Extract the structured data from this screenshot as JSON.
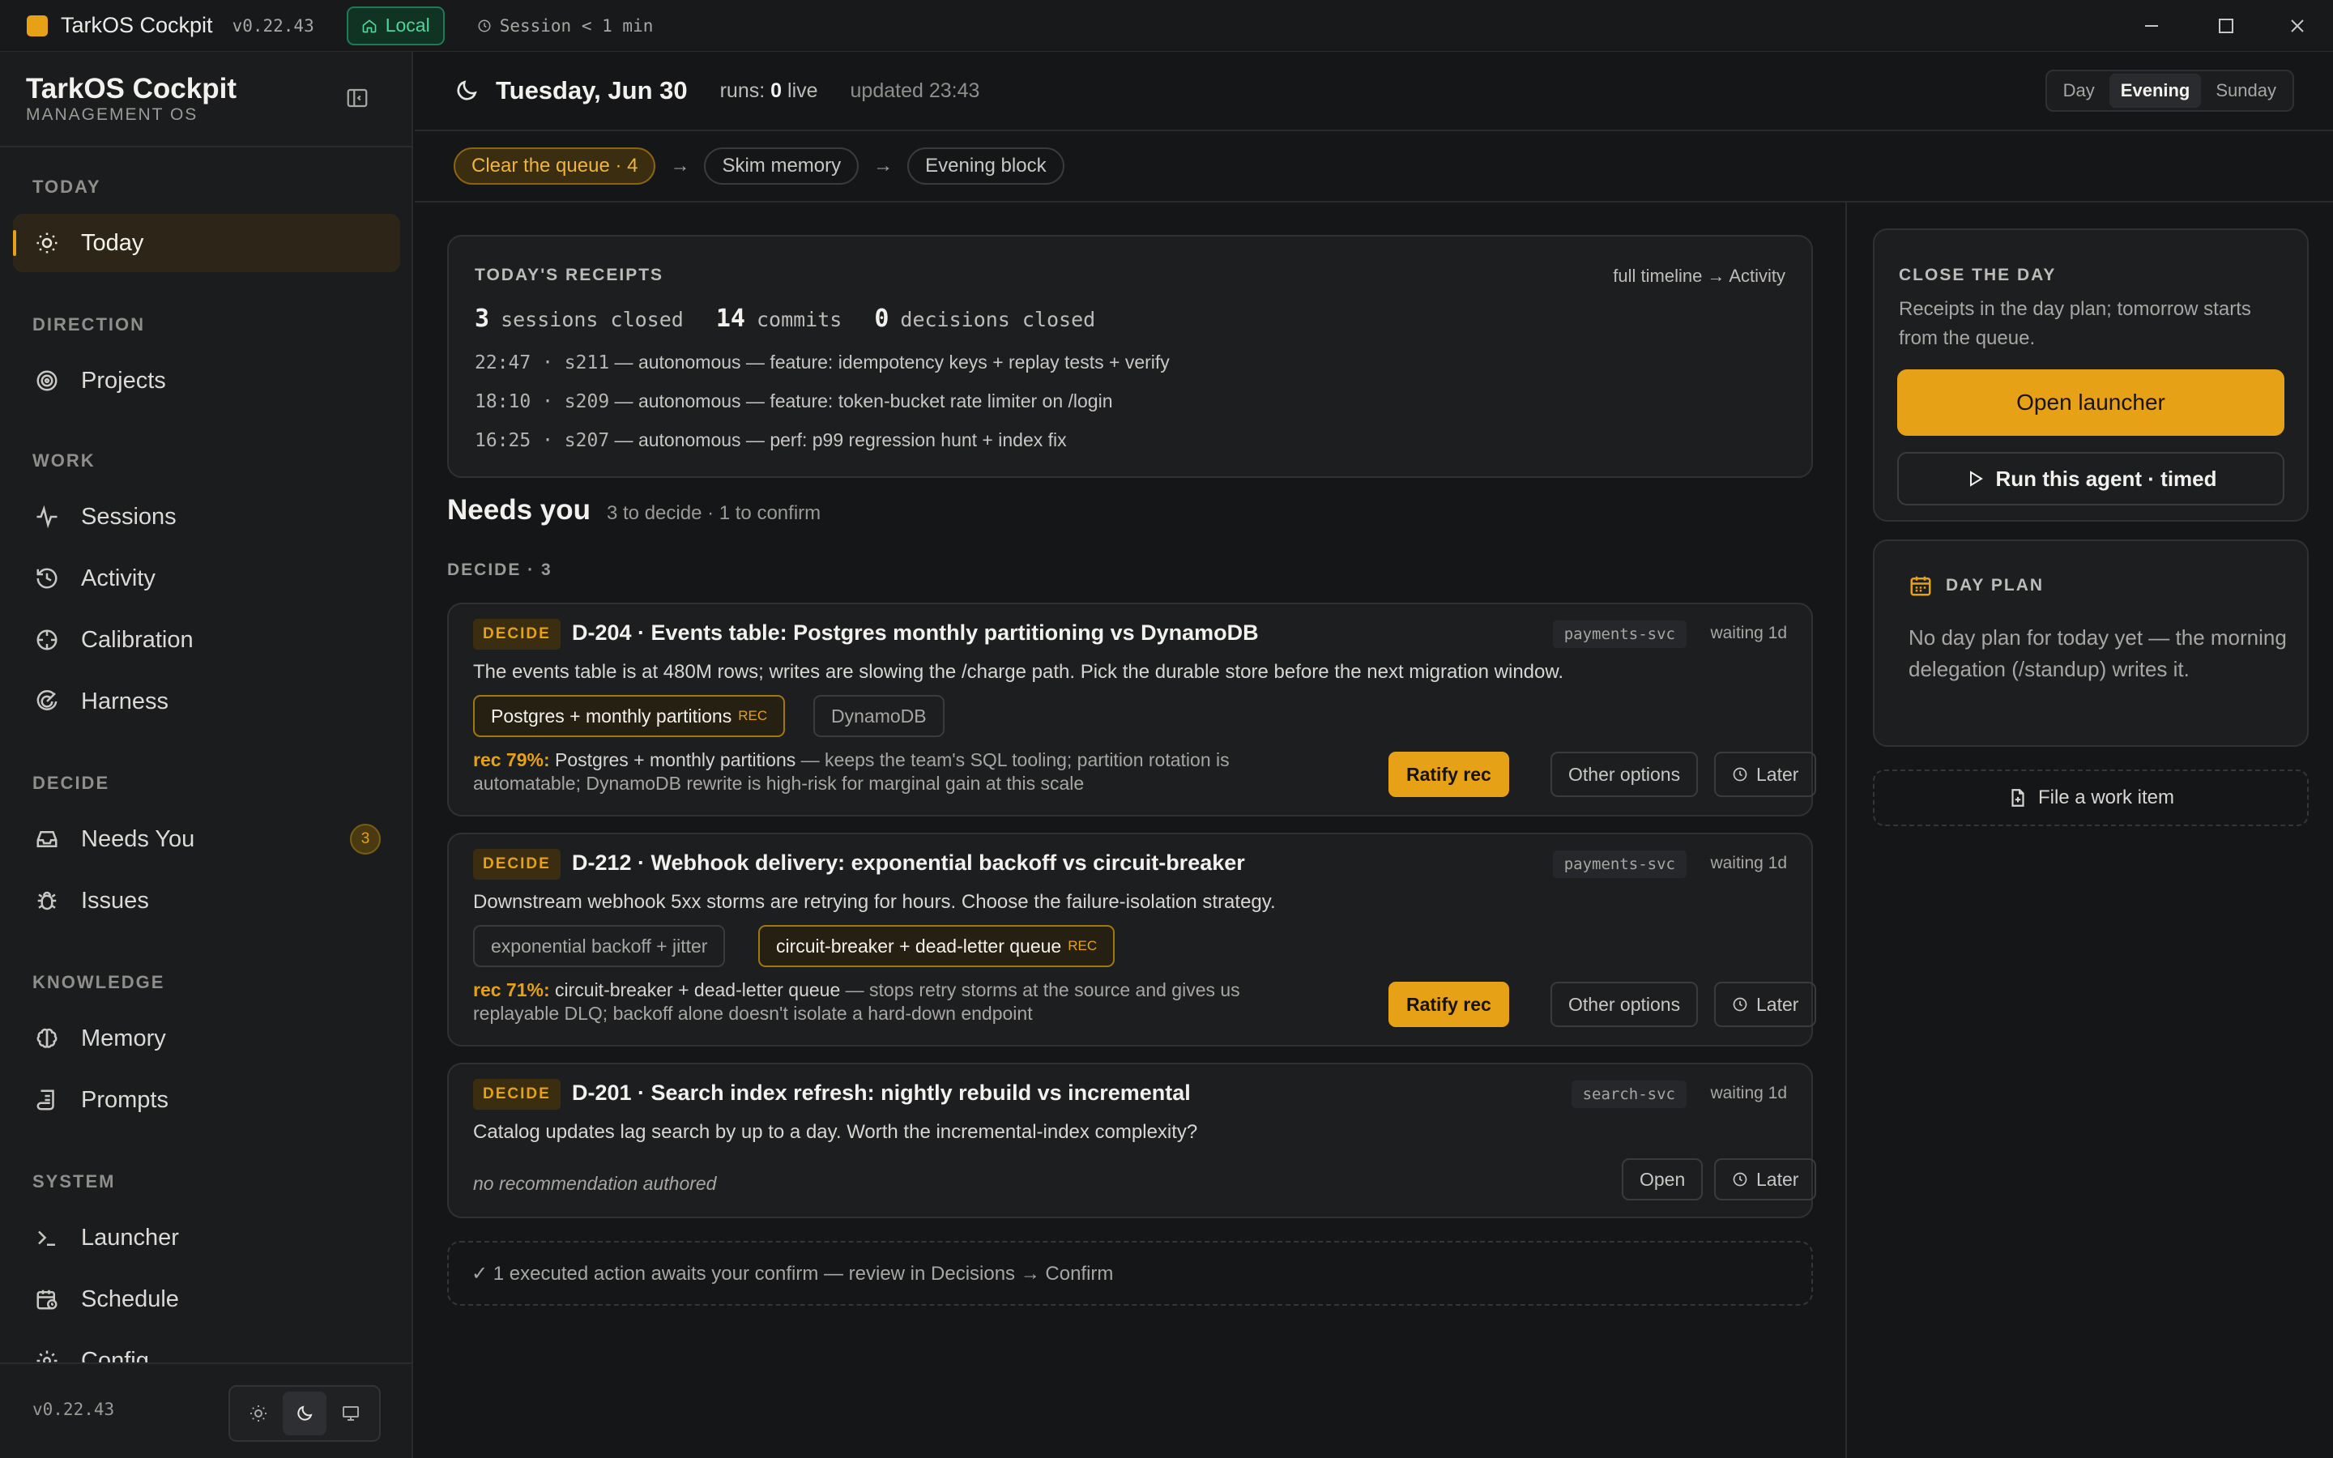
{
  "window": {
    "app_name": "TarkOS Cockpit",
    "version": "v0.22.43",
    "env_label": "Local",
    "session_label": "Session < 1 min"
  },
  "sidebar": {
    "brand_title": "TarkOS Cockpit",
    "brand_subtitle": "MANAGEMENT OS",
    "sections": {
      "today": "TODAY",
      "direction": "DIRECTION",
      "work": "WORK",
      "decide": "DECIDE",
      "knowledge": "KNOWLEDGE",
      "system": "SYSTEM"
    },
    "items": {
      "today": "Today",
      "projects": "Projects",
      "sessions": "Sessions",
      "activity": "Activity",
      "calibration": "Calibration",
      "harness": "Harness",
      "needs_you": "Needs You",
      "needs_you_count": "3",
      "issues": "Issues",
      "memory": "Memory",
      "prompts": "Prompts",
      "launcher": "Launcher",
      "schedule": "Schedule",
      "config": "Config"
    },
    "footer_version": "v0.22.43"
  },
  "topbar": {
    "date": "Tuesday, Jun 30",
    "runs_label": "runs:",
    "runs_count": "0",
    "runs_suffix": "live",
    "updated": "updated 23:43",
    "modes": [
      "Day",
      "Evening",
      "Sunday"
    ],
    "active_mode": "Evening"
  },
  "flow": {
    "steps": [
      "Clear the queue · 4",
      "Skim memory",
      "Evening block"
    ],
    "arrow": "→"
  },
  "receipts": {
    "caption": "TODAY'S RECEIPTS",
    "link": "full timeline → Activity",
    "stats": [
      {
        "value": "3",
        "label": "sessions closed"
      },
      {
        "value": "14",
        "label": "commits"
      },
      {
        "value": "0",
        "label": "decisions closed"
      }
    ],
    "lines": [
      {
        "meta": "22:47 · s211",
        "text": " — autonomous — feature: idempotency keys + replay tests + verify"
      },
      {
        "meta": "18:10 · s209",
        "text": " — autonomous — feature: token-bucket rate limiter on /login"
      },
      {
        "meta": "16:25 · s207",
        "text": " — autonomous — perf: p99 regression hunt + index fix"
      }
    ]
  },
  "needs_you": {
    "title": "Needs you",
    "summary": "3 to decide · 1 to confirm",
    "decide_caption": "DECIDE · 3",
    "tag": "DECIDE",
    "waiting": "waiting 1d",
    "rec_badge": "REC",
    "ratify": "Ratify rec",
    "other": "Other options",
    "later": "Later",
    "open": "Open",
    "decisions": [
      {
        "title": "D-204 · Events table: Postgres monthly partitioning vs DynamoDB",
        "service": "payments-svc",
        "description": "The events table is at 480M rows; writes are slowing the /charge path. Pick the durable store before the next migration window.",
        "options": [
          "Postgres + monthly partitions",
          "DynamoDB"
        ],
        "rec_pct": "rec 79%:",
        "rec_name": "Postgres + monthly partitions",
        "rec_reason": " — keeps the team's SQL tooling; partition rotation is automatable; DynamoDB rewrite is high-risk for marginal gain at this scale"
      },
      {
        "title": "D-212 · Webhook delivery: exponential backoff vs circuit-breaker",
        "service": "payments-svc",
        "description": "Downstream webhook 5xx storms are retrying for hours. Choose the failure-isolation strategy.",
        "options": [
          "exponential backoff + jitter",
          "circuit-breaker + dead-letter queue"
        ],
        "rec_pct": "rec 71%:",
        "rec_name": "circuit-breaker + dead-letter queue",
        "rec_reason": " — stops retry storms at the source and gives us replayable DLQ; backoff alone doesn't isolate a hard-down endpoint"
      },
      {
        "title": "D-201 · Search index refresh: nightly rebuild vs incremental",
        "service": "search-svc",
        "description": "Catalog updates lag search by up to a day. Worth the incremental-index complexity?",
        "no_rec": "no recommendation authored"
      }
    ],
    "confirm_note": "✓ 1 executed action awaits your confirm — review in Decisions → Confirm"
  },
  "right_panel": {
    "close_caption": "CLOSE THE DAY",
    "close_desc": "Receipts in the day plan; tomorrow starts from the queue.",
    "open_launcher": "Open launcher",
    "run_agent": "Run this agent · timed",
    "dayplan_caption": "DAY PLAN",
    "dayplan_desc": "No day plan for today yet — the morning delegation (/standup) writes it.",
    "file_work_item": "File a work item"
  },
  "colors": {
    "accent": "#e6a117",
    "background": "#151618",
    "local_green": "#4fd59a"
  }
}
